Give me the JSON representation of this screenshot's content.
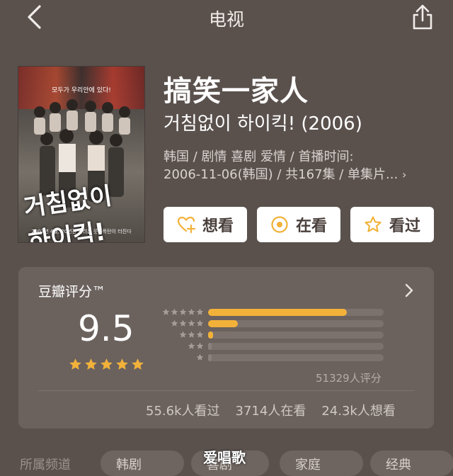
{
  "topbar": {
    "title": "电视",
    "back_icon": "chevron-left-icon",
    "share_icon": "share-icon"
  },
  "poster": {
    "tagline": "모두가 우리안에 있다!",
    "art_title": "거침없이 하이킥!",
    "date_text": "2007년 4월, 20년간 밀려온 웃음폭탄이 터진다"
  },
  "show": {
    "title": "搞笑一家人",
    "original_title": "거침없이 하이킥! (2006)",
    "meta_line1": "韩国 / 剧情 喜剧 爱情 / 首播时间:",
    "meta_line2": "2006-11-06(韩国) / 共167集 / 单集片..."
  },
  "actions": [
    {
      "label": "想看",
      "icon": "heart-plus-icon"
    },
    {
      "label": "在看",
      "icon": "target-icon"
    },
    {
      "label": "看过",
      "icon": "star-outline-icon"
    }
  ],
  "rating": {
    "label": "豆瓣评分™",
    "score": "9.5",
    "stars": 5,
    "distribution": [
      {
        "stars": 5,
        "fraction": 0.79
      },
      {
        "stars": 4,
        "fraction": 0.17
      },
      {
        "stars": 3,
        "fraction": 0.03
      },
      {
        "stars": 2,
        "fraction": 0.005
      },
      {
        "stars": 1,
        "fraction": 0.003
      }
    ],
    "count_text": "51329人评分",
    "watched": "55.6k人看过",
    "watching": "3714人在看",
    "want": "24.3k人想看"
  },
  "bottom": {
    "section_label": "所属频道",
    "chips": [
      "韩剧",
      "喜剧",
      "家庭",
      "经典"
    ]
  },
  "watermark": "爱唱歌",
  "colors": {
    "accent": "#f2b23a",
    "background": "#5a514d",
    "card": "#6b625e"
  }
}
